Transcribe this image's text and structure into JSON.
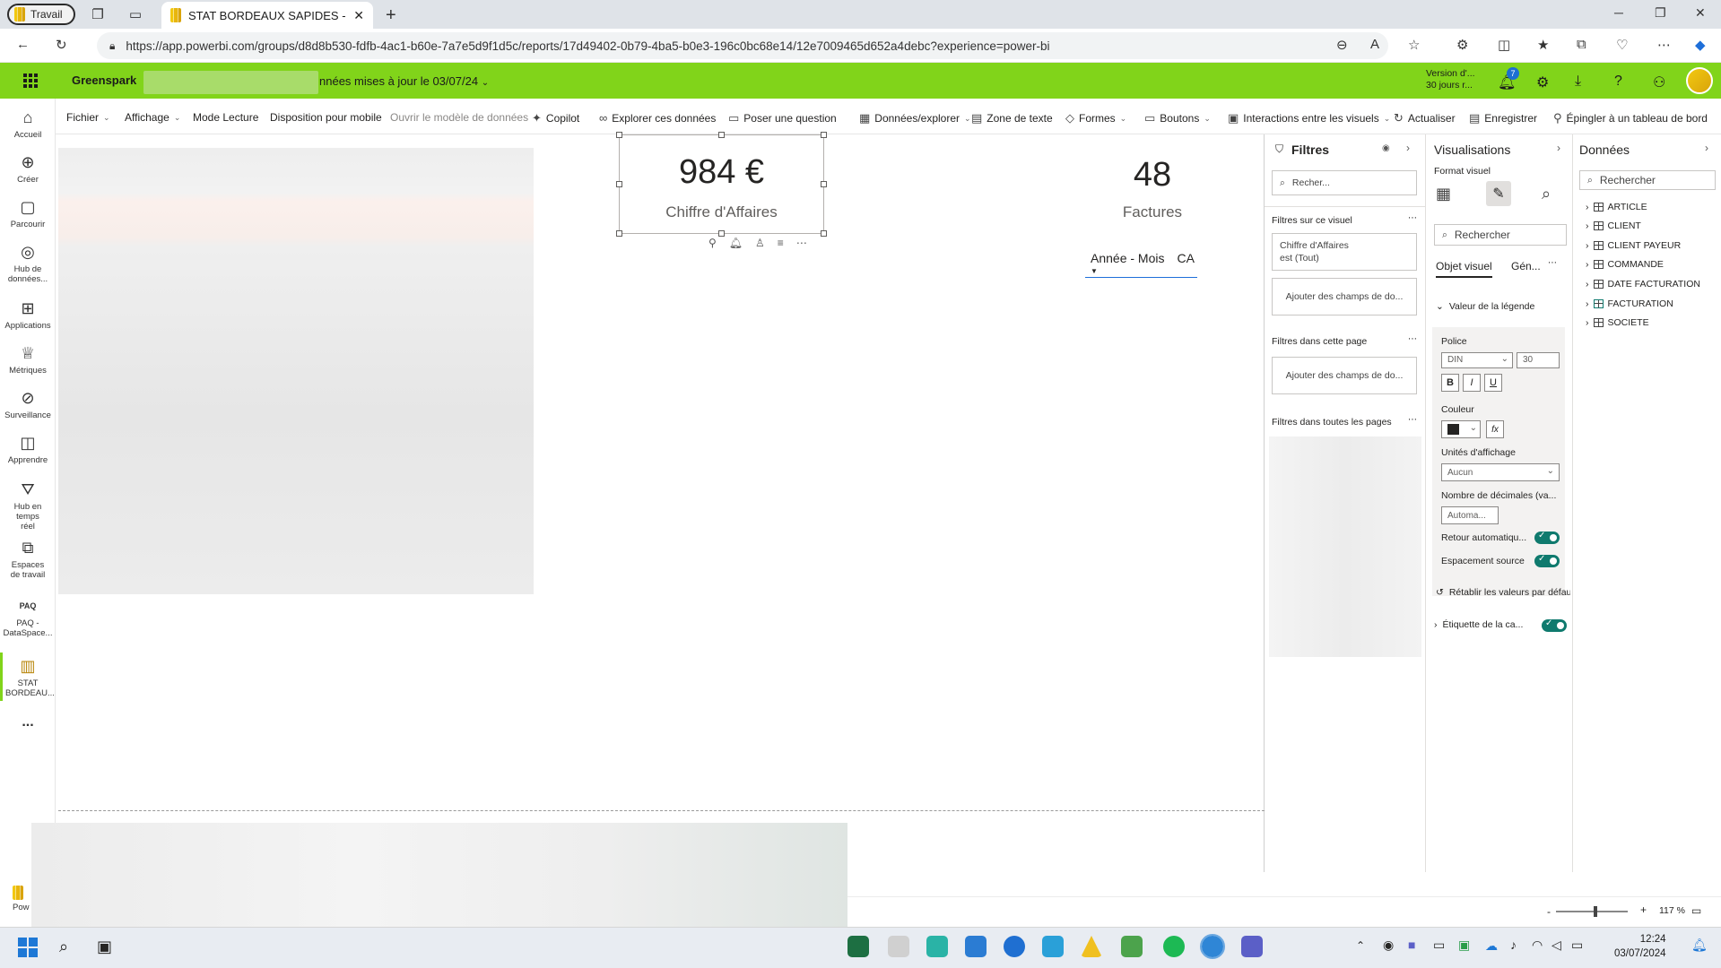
{
  "browser": {
    "profile_label": "Travail",
    "tab_title": "STAT BORDEAUX SAPIDES - Pow",
    "url": "https://app.powerbi.com/groups/d8d8b530-fdfb-4ac1-b60e-7a7e5d9f1d5c/reports/17d49402-0b79-4ba5-b0e3-196c0bc68e14/12e7009465d652a4debc?experience=power-bi"
  },
  "header": {
    "workspace": "Greenspark",
    "report_title_suffix": "nnées mises à jour le 03/07/24",
    "version_line1": "Version d'...",
    "version_line2": "30 jours r...",
    "notification_count": "7"
  },
  "leftnav": [
    {
      "label": "Accueil",
      "icon": "home-icon"
    },
    {
      "label": "Créer",
      "icon": "plus-circle-icon"
    },
    {
      "label": "Parcourir",
      "icon": "folder-icon"
    },
    {
      "label": "Hub de données...",
      "icon": "data-hub-icon"
    },
    {
      "label": "Applications",
      "icon": "apps-icon"
    },
    {
      "label": "Métriques",
      "icon": "trophy-icon"
    },
    {
      "label": "Surveillance",
      "icon": "monitor-icon"
    },
    {
      "label": "Apprendre",
      "icon": "book-icon"
    },
    {
      "label": "Hub en temps réel",
      "icon": "realtime-icon"
    },
    {
      "label": "Espaces de travail",
      "icon": "workspaces-icon"
    },
    {
      "label": "PAQ - DataSpace...",
      "icon": "paq-icon",
      "badge": "PAQ"
    },
    {
      "label": "STAT BORDEAU...",
      "icon": "report-icon"
    },
    {
      "label": "...",
      "icon": "more-icon"
    }
  ],
  "ribbon": [
    {
      "label": "Fichier",
      "dropdown": true
    },
    {
      "label": "Affichage",
      "dropdown": true
    },
    {
      "label": "Mode Lecture"
    },
    {
      "label": "Disposition pour mobile"
    },
    {
      "label": "Ouvrir le modèle de données",
      "dim": true
    },
    {
      "label": "Copilot",
      "icon": "copilot-icon"
    },
    {
      "label": "Explorer ces données",
      "icon": "binoculars-icon"
    },
    {
      "label": "Poser une question",
      "icon": "chat-icon"
    },
    {
      "label": "Données/explorer",
      "dropdown": true,
      "icon": "data-icon"
    },
    {
      "label": "Zone de texte",
      "icon": "textbox-icon"
    },
    {
      "label": "Formes",
      "dropdown": true,
      "icon": "shapes-icon"
    },
    {
      "label": "Boutons",
      "dropdown": true,
      "icon": "buttons-icon"
    },
    {
      "label": "Interactions entre les visuels",
      "dropdown": true,
      "icon": "interactions-icon"
    },
    {
      "label": "Actualiser",
      "icon": "refresh-icon"
    },
    {
      "label": "Enregistrer",
      "icon": "save-icon"
    },
    {
      "label": "Épingler à un tableau de bord",
      "icon": "pin-icon"
    }
  ],
  "canvas": {
    "card_ca": {
      "value": "984 €",
      "label": "Chiffre d'Affaires"
    },
    "card_factures": {
      "value": "48",
      "label": "Factures"
    },
    "mini_table": {
      "col1": "Année - Mois",
      "col2": "CA"
    }
  },
  "filters": {
    "title": "Filtres",
    "search_placeholder": "Recher...",
    "on_visual": "Filtres sur ce visuel",
    "visual_filter_line1": "Chiffre d'Affaires",
    "visual_filter_line2": "est (Tout)",
    "add_fields": "Ajouter des champs de do...",
    "on_page": "Filtres dans cette page",
    "all_pages": "Filtres dans toutes les pages"
  },
  "visualisations": {
    "title": "Visualisations",
    "format_label": "Format visuel",
    "search_placeholder": "Rechercher",
    "tab_visual": "Objet visuel",
    "tab_general": "Gén...",
    "section_legend_value": "Valeur de la légende",
    "font_label": "Police",
    "font_name": "DIN",
    "font_size": "30",
    "bold": "B",
    "italic": "I",
    "underline": "U",
    "color_label": "Couleur",
    "fx": "fx",
    "display_units_label": "Unités d'affichage",
    "display_units_value": "Aucun",
    "decimals_label": "Nombre de décimales (va...",
    "decimals_value": "Automa...",
    "auto_wrap_label": "Retour automatiqu...",
    "source_spacing_label": "Espacement source",
    "reset_label": "Rétablir les valeurs par défaut",
    "section_category_label": "Étiquette de la ca..."
  },
  "data_pane": {
    "title": "Données",
    "search_placeholder": "Rechercher",
    "tables": [
      "ARTICLE",
      "CLIENT",
      "CLIENT PAYEUR",
      "COMMANDE",
      "DATE FACTURATION",
      "FACTURATION",
      "SOCIETE"
    ]
  },
  "statusbar": {
    "zoom": "117 %",
    "footer_partial": "Pow"
  },
  "taskbar": {
    "time": "12:24",
    "date": "03/07/2024"
  },
  "colors": {
    "pbi_green": "#81d41a",
    "toggle_on": "#0f7a6e",
    "accent_blue": "#1e6fd9"
  }
}
